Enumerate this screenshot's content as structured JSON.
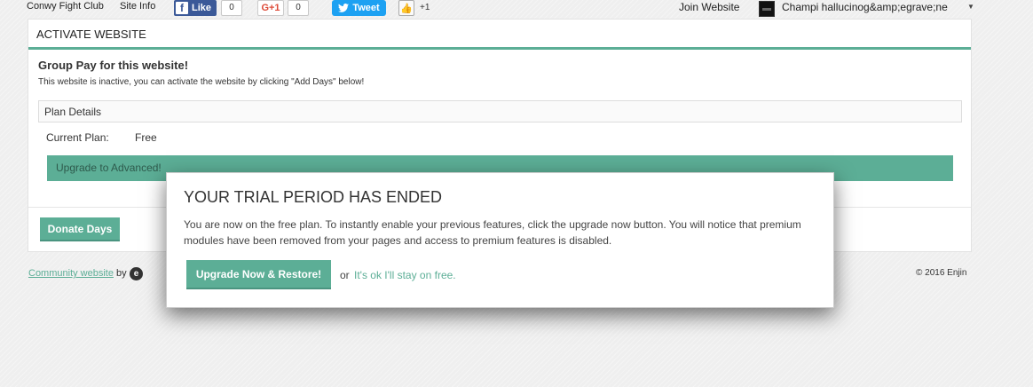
{
  "topbar": {
    "site_name": "Conwy Fight Club",
    "site_info": "Site Info",
    "fb_like_label": "Like",
    "fb_like_count": "0",
    "gplus_label": "G+1",
    "gplus_count": "0",
    "tweet_label": "Tweet",
    "plus_one": "+1",
    "join_label": "Join Website",
    "username": "Champi hallucinog&amp;egrave;ne"
  },
  "panel": {
    "header": "ACTIVATE WEBSITE",
    "group_pay_title": "Group Pay for this website!",
    "group_pay_desc": "This website is inactive, you can activate the website by clicking \"Add Days\" below!",
    "plan_details_label": "Plan Details",
    "current_plan_label": "Current Plan:",
    "current_plan_value": "Free",
    "upgrade_label": "Upgrade to Advanced!",
    "donate_label": "Donate Days"
  },
  "footer": {
    "community_link": "Community website ",
    "by": "by",
    "copyright": "© 2016 Enjin"
  },
  "modal": {
    "title": "YOUR TRIAL PERIOD HAS ENDED",
    "body": "You are now on the free plan. To instantly enable your previous features, click the upgrade now button. You will notice that premium modules have been removed from your pages and access to premium features is disabled.",
    "upgrade_button": "Upgrade Now & Restore!",
    "or": "or",
    "stay_link": "It's ok I'll stay on free."
  },
  "colors": {
    "accent": "#5cae96",
    "facebook": "#3b5998",
    "twitter": "#1da1f2",
    "gplus": "#dd4b39"
  }
}
